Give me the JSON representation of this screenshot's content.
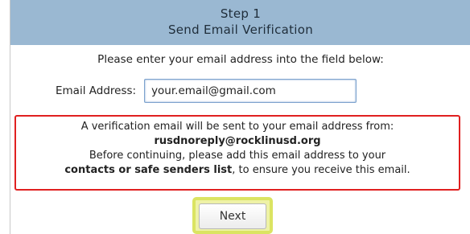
{
  "header": {
    "step": "Step 1",
    "title": "Send Email Verification"
  },
  "instruction": "Please enter your email address into the field below:",
  "email": {
    "label": "Email Address:",
    "value": "your.email@gmail.com"
  },
  "notice": {
    "line1": "A verification email will be sent to your email address from:",
    "sender": "rusdnoreply@rocklinusd.org",
    "line3": "Before continuing, please add this email address to your",
    "line4_bold": "contacts or safe senders list",
    "line4_rest": ", to ensure you receive this email."
  },
  "next_label": "Next",
  "colors": {
    "header_bg": "#9ab8d2",
    "notice_border": "#e02020",
    "highlight": "#dbe462"
  }
}
